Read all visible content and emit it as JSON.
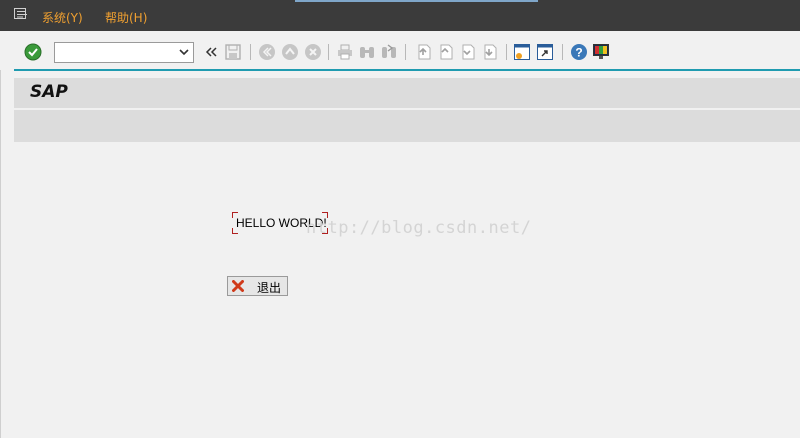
{
  "menubar": {
    "items": [
      {
        "label": "系统(Y)"
      },
      {
        "label": "帮助(H)"
      }
    ]
  },
  "toolbar": {
    "command_field": {
      "value": ""
    },
    "icons": [
      "enter-icon",
      "collapse-icon",
      "save-icon",
      "back-icon",
      "exit-icon",
      "cancel-icon",
      "print-icon",
      "find-icon",
      "find-next-icon",
      "first-page-icon",
      "previous-page-icon",
      "next-page-icon",
      "last-page-icon",
      "create-session-icon",
      "shortcut-icon",
      "help-icon",
      "customize-layout-icon"
    ]
  },
  "title": {
    "text": "SAP"
  },
  "screen": {
    "output_text": "HELLO WORLD!",
    "exit_button_label": "退出"
  },
  "watermark": {
    "text": "http://blog.csdn.net/"
  },
  "colors": {
    "menu_text": "#f0a030",
    "accent_line": "#1f9bb0",
    "menubar_bg": "#3b3b3b"
  }
}
